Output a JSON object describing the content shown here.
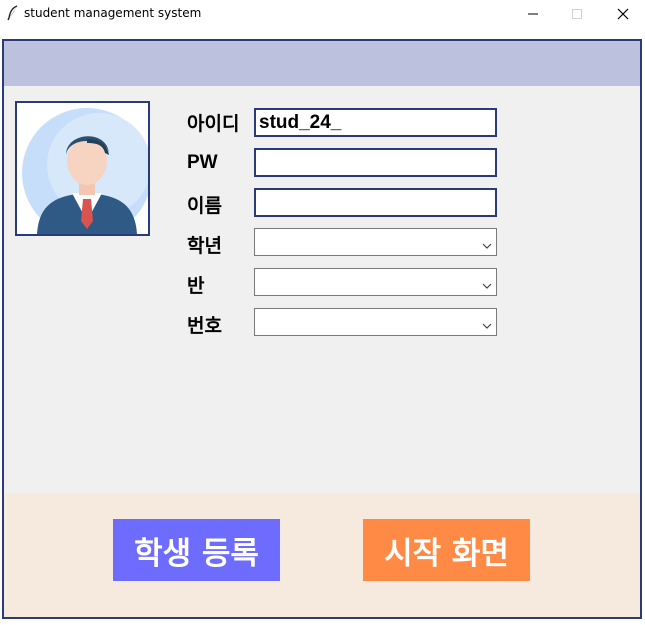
{
  "window": {
    "title": "student management system",
    "icon": "feather-icon",
    "controls": [
      "minimize-icon",
      "maximize-icon",
      "close-icon"
    ]
  },
  "colors": {
    "frame_border": "#2b3a78",
    "header_band": "#bcc2de",
    "form_background": "#f0f0f0",
    "footer_band": "#f6eadf",
    "register_button": "#6d6cff",
    "start_button": "#ff8a45"
  },
  "profile": {
    "image": "student-avatar-icon"
  },
  "form": {
    "id": {
      "label": "아이디",
      "value": "stud_24_"
    },
    "pw": {
      "label": "PW",
      "value": ""
    },
    "name": {
      "label": "이름",
      "value": ""
    },
    "grade": {
      "label": "학년",
      "value": ""
    },
    "class": {
      "label": "반",
      "value": ""
    },
    "number": {
      "label": "번호",
      "value": ""
    }
  },
  "buttons": {
    "register": "학생 등록",
    "start_screen": "시작 화면"
  }
}
